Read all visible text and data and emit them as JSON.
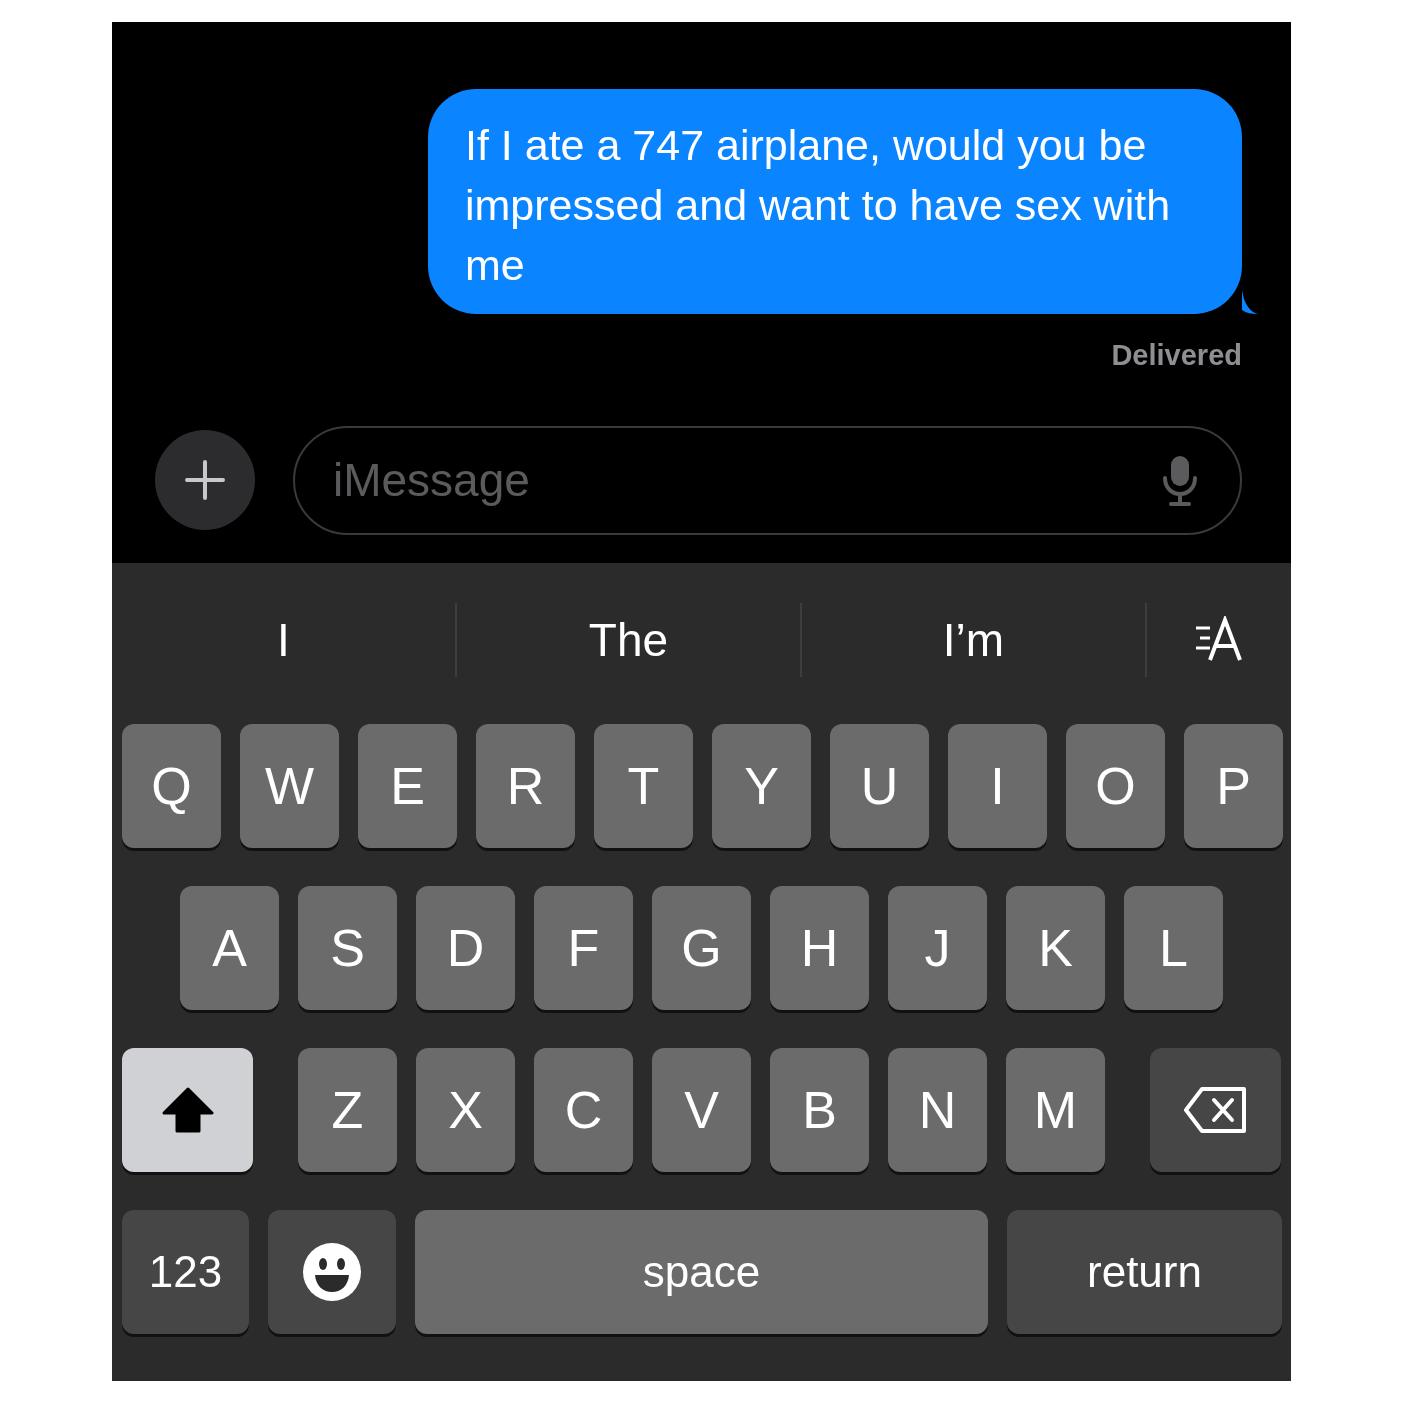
{
  "message": {
    "text": "If I ate a 747 airplane, would you be impressed and want to have sex with me",
    "status": "Delivered"
  },
  "compose": {
    "placeholder": "iMessage"
  },
  "suggestions": [
    {
      "kind": "word",
      "label": "I"
    },
    {
      "kind": "word",
      "label": "The"
    },
    {
      "kind": "word",
      "label": "I’m"
    },
    {
      "kind": "format"
    }
  ],
  "keyboard": [
    [
      {
        "kind": "letter",
        "label": "Q"
      },
      {
        "kind": "letter",
        "label": "W"
      },
      {
        "kind": "letter",
        "label": "E"
      },
      {
        "kind": "letter",
        "label": "R"
      },
      {
        "kind": "letter",
        "label": "T"
      },
      {
        "kind": "letter",
        "label": "Y"
      },
      {
        "kind": "letter",
        "label": "U"
      },
      {
        "kind": "letter",
        "label": "I"
      },
      {
        "kind": "letter",
        "label": "O"
      },
      {
        "kind": "letter",
        "label": "P"
      }
    ],
    [
      {
        "kind": "letter",
        "label": "A"
      },
      {
        "kind": "letter",
        "label": "S"
      },
      {
        "kind": "letter",
        "label": "D"
      },
      {
        "kind": "letter",
        "label": "F"
      },
      {
        "kind": "letter",
        "label": "G"
      },
      {
        "kind": "letter",
        "label": "H"
      },
      {
        "kind": "letter",
        "label": "J"
      },
      {
        "kind": "letter",
        "label": "K"
      },
      {
        "kind": "letter",
        "label": "L"
      }
    ],
    [
      {
        "kind": "shift",
        "on": true
      },
      {
        "kind": "letter",
        "label": "Z"
      },
      {
        "kind": "letter",
        "label": "X"
      },
      {
        "kind": "letter",
        "label": "C"
      },
      {
        "kind": "letter",
        "label": "V"
      },
      {
        "kind": "letter",
        "label": "B"
      },
      {
        "kind": "letter",
        "label": "N"
      },
      {
        "kind": "letter",
        "label": "M"
      },
      {
        "kind": "delete"
      }
    ],
    [
      {
        "kind": "numbers",
        "label": "123"
      },
      {
        "kind": "emoji"
      },
      {
        "kind": "space",
        "label": "space"
      },
      {
        "kind": "return",
        "label": "return"
      }
    ]
  ]
}
